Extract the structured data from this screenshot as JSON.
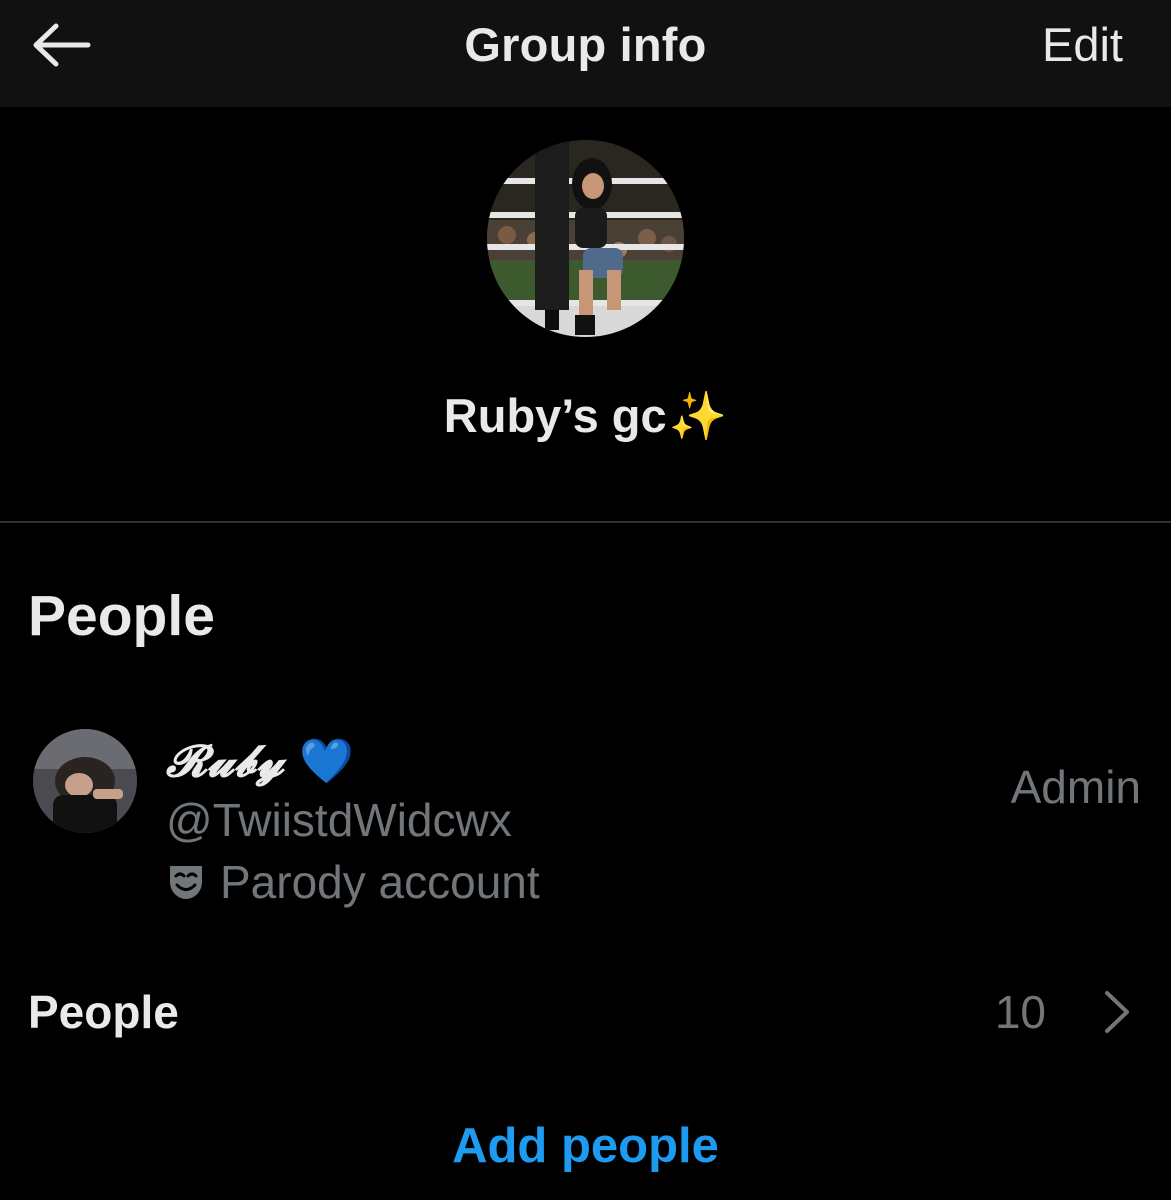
{
  "header": {
    "title": "Group info",
    "back_icon": "arrow-left-icon",
    "edit_label": "Edit"
  },
  "group": {
    "name": "Ruby’s gc",
    "name_emoji": "✨"
  },
  "people_section": {
    "heading": "People",
    "members": [
      {
        "display_name": "𝓡𝓾𝓫𝔂",
        "name_emoji": "💙",
        "handle": "@TwiistdWidcwx",
        "label": "Parody account",
        "label_icon": "theater-mask-icon",
        "role": "Admin"
      }
    ],
    "row_label": "People",
    "count": "10",
    "chevron_icon": "chevron-right-icon"
  },
  "actions": {
    "add_people": "Add people"
  },
  "colors": {
    "background": "#000000",
    "header_background": "#111112",
    "primary_text": "#e7e9ea",
    "secondary_text": "#71767b",
    "accent": "#1d9bf0",
    "divider": "#2f3336"
  }
}
